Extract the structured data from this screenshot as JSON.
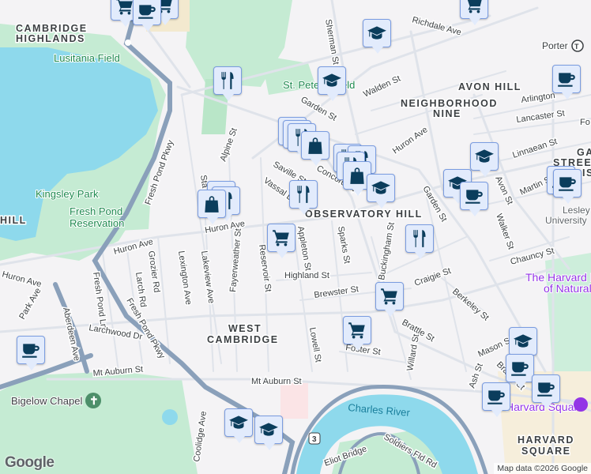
{
  "map": {
    "neighborhoods": {
      "cambridge_highlands_1": "CAMBRIDGE",
      "cambridge_highlands_2": "HIGHLANDS",
      "avon_hill": "AVON HILL",
      "neighborhood_nine_1": "NEIGHBORHOOD",
      "neighborhood_nine_2": "NINE",
      "observatory_hill": "OBSERVATORY HILL",
      "west_cambridge_1": "WEST",
      "west_cambridge_2": "CAMBRIDGE",
      "harvard_square_1": "HARVARD",
      "harvard_square_2": "SQUARE",
      "hill": "HILL",
      "gas_1": "GA",
      "gas_2": "STREET",
      "gas_3": "IS"
    },
    "parks": {
      "lusitania": "Lusitania Field",
      "kingsley": "Kingsley Park",
      "fresh_pond_1": "Fresh Pond",
      "fresh_pond_2": "Reservation",
      "st_peters": "St. Peter's Field",
      "bigelow": "Bigelow Chapel"
    },
    "pois": {
      "harvard_museum_1": "The Harvard M",
      "harvard_museum_2": "of Natural",
      "harvard_square": "Harvard Square",
      "lesley_1": "Lesley",
      "lesley_2": "University",
      "porter": "Porter"
    },
    "water": {
      "charles": "Charles River"
    },
    "route_shield": "3",
    "streets": {
      "fresh_pond_pkwy": "Fresh Pond Pkwy",
      "fresh_pond_pkwy_2": "Fresh Pond Pkwy",
      "alpine": "Alpine St",
      "huron_1": "Huron Ave",
      "huron_2": "Huron Ave",
      "huron_3": "Huron Ave",
      "huron_4": "Huron Ave",
      "saville": "Saville St",
      "vassal": "Vassal Ln",
      "concord": "Concord Ave",
      "garden_1": "Garden St",
      "garden_2": "Garden St",
      "walden": "Walden St",
      "sherman": "Sherman St",
      "richdale": "Richdale Ave",
      "arlington": "Arlington",
      "lancaster": "Lancaster St",
      "fo": "Fo",
      "linnaean": "Linnaean St",
      "avon": "Avon St",
      "martin": "Martin St",
      "walker": "Walker St",
      "appleton": "Appleton St",
      "sparks": "Sparks St",
      "buckingham": "Buckingham St",
      "highland": "Highland St",
      "brewster": "Brewster St",
      "craigie": "Craigie St",
      "berkeley": "Berkeley St",
      "chauncy": "Chauncy St",
      "brattle_1": "Brattle St",
      "brattle_2": "Brattle St",
      "mason": "Mason St",
      "lowell": "Lowell St",
      "foster": "Foster St",
      "willard": "Willard St",
      "ash": "Ash St",
      "mt_auburn_1": "Mt Auburn St",
      "mt_auburn_2": "Mt Auburn St",
      "eliot": "Eliot Bridge",
      "soldiers": "Soldiers Fld Rd",
      "coolidge": "Coolidge Ave",
      "lakeview": "Lakeview Ave",
      "lexington": "Lexington Ave",
      "grozier": "Grozier Rd",
      "larch": "Larch Rd",
      "fresh_pond_ln": "Fresh Pond Ln",
      "larchwood": "Larchwood Dr",
      "park_ave": "Park Ave",
      "aberdeen": "Aberdeen Ave",
      "fayerweather": "Fayerweather St",
      "reservoir": "Reservoir St",
      "stark": "Sta"
    },
    "attribution": "Map data ©2026 Google",
    "logo": "Google"
  },
  "colors": {
    "marker_bg": "#e2ebfc",
    "marker_border": "#7a9ce0",
    "marker_icon": "#0b3d5c",
    "water": "#8ed9ec",
    "park": "#c5ebd3",
    "road": "#dfe3ea",
    "highway": "#8aa0ba"
  }
}
